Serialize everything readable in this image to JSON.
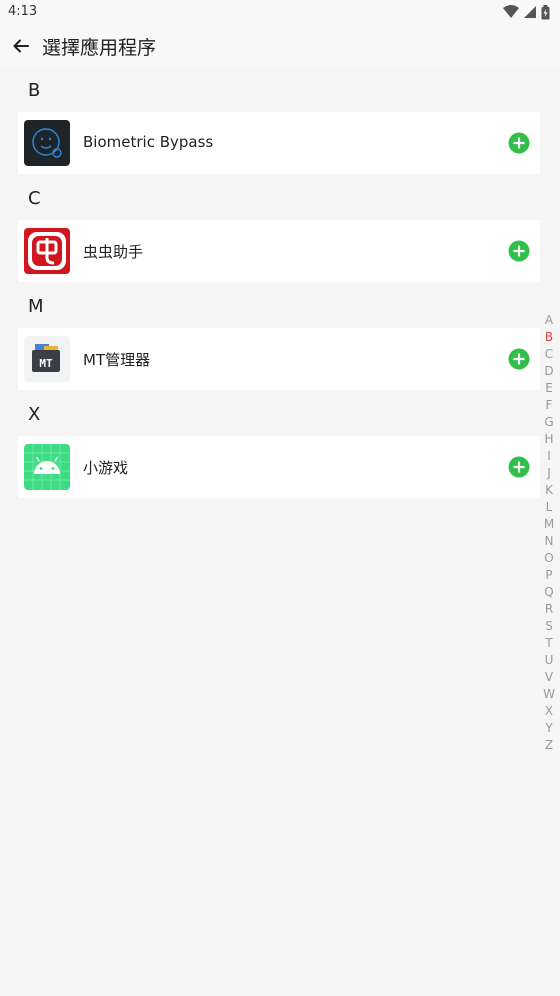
{
  "status_bar": {
    "time": "4:13"
  },
  "header": {
    "title": "選擇應用程序"
  },
  "sections": [
    {
      "letter": "B",
      "app": {
        "name": "Biometric Bypass",
        "icon": "biometric-bypass-icon"
      }
    },
    {
      "letter": "C",
      "app": {
        "name": "虫虫助手",
        "icon": "chongchong-icon"
      }
    },
    {
      "letter": "M",
      "app": {
        "name": "MT管理器",
        "icon": "mt-manager-icon"
      }
    },
    {
      "letter": "X",
      "app": {
        "name": "小游戏",
        "icon": "android-icon"
      }
    }
  ],
  "index_bar": {
    "letters": [
      "A",
      "B",
      "C",
      "D",
      "E",
      "F",
      "G",
      "H",
      "I",
      "J",
      "K",
      "L",
      "M",
      "N",
      "O",
      "P",
      "Q",
      "R",
      "S",
      "T",
      "U",
      "V",
      "W",
      "X",
      "Y",
      "Z"
    ],
    "active": "B"
  },
  "colors": {
    "accent_green": "#2fbf4a",
    "active_index": "#d9443a",
    "background": "#f5f5f5"
  }
}
